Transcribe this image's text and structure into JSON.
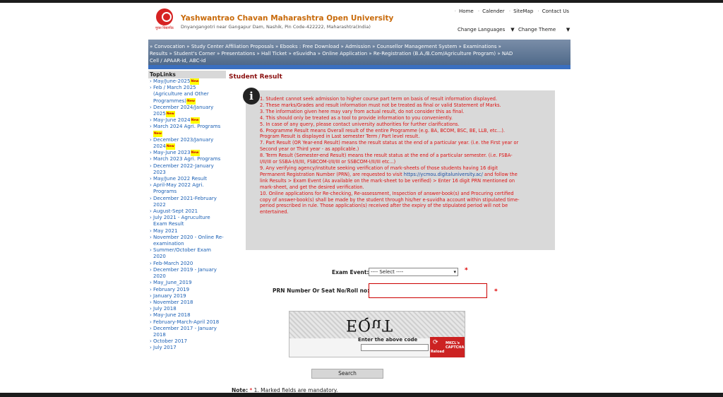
{
  "header": {
    "logo_caption": "मुक्त विद्यापीठ",
    "university_name": "Yashwantrao Chavan Maharashtra Open University",
    "address": "Dnyangangotri near Gangapur Dam, Nashik, Pin Code-422222, Maharashtra(India)",
    "top_links": [
      "Home",
      "Calender",
      "SiteMap",
      "Contact Us"
    ],
    "change_languages": "Change Languages",
    "change_theme": "Change Theme"
  },
  "nav": {
    "line1": "» Convocation   » Study Center Affiliation Proposals   » Ebooks : Free Download   » Admission   » Counsellor Management System   » Examinations   »",
    "line2": "Results   » Student's Corner   » Presentations   » Hall Ticket   » eSuvidha   » Online Application   » Re-Registration (B.A./B.Com/Agriculture Program)   » NAD",
    "line3": "Cell / APAAR-id, ABC-id"
  },
  "sidebar": {
    "heading": "TopLinks",
    "new_badge": "New",
    "items": [
      {
        "label": "May/June-2025",
        "new": true
      },
      {
        "label": "Feb / March 2025 (Agriculture and Other Programmes)",
        "new": true
      },
      {
        "label": "December 2024/January 2025",
        "new": true
      },
      {
        "label": "May-June 2024",
        "new": true
      },
      {
        "label": "March 2024 Agri. Programs",
        "new": true
      },
      {
        "label": "December 2023/January 2024",
        "new": true
      },
      {
        "label": "May-June 2023",
        "new": true
      },
      {
        "label": "March 2023 Agri. Programs",
        "new": false
      },
      {
        "label": "December 2022-January 2023",
        "new": false
      },
      {
        "label": "May/June 2022 Result",
        "new": false
      },
      {
        "label": "April-May 2022 Agri. Programs",
        "new": false
      },
      {
        "label": "December 2021-February 2022",
        "new": false
      },
      {
        "label": "August-Sept 2021",
        "new": false
      },
      {
        "label": "July 2021 - Agruculture Exam Result",
        "new": false
      },
      {
        "label": "May 2021",
        "new": false
      },
      {
        "label": "November 2020 - Online Re-examination",
        "new": false
      },
      {
        "label": "Summer/October Exam 2020",
        "new": false
      },
      {
        "label": "Feb-March 2020",
        "new": false
      },
      {
        "label": "December 2019 - January 2020",
        "new": false
      },
      {
        "label": "May_June_2019",
        "new": false
      },
      {
        "label": "February 2019",
        "new": false
      },
      {
        "label": "January 2019",
        "new": false
      },
      {
        "label": "November 2018",
        "new": false
      },
      {
        "label": "July 2018",
        "new": false
      },
      {
        "label": "May-June 2018",
        "new": false
      },
      {
        "label": "February-March-April 2018",
        "new": false
      },
      {
        "label": "December 2017 - January 2018",
        "new": false
      },
      {
        "label": "October 2017",
        "new": false
      },
      {
        "label": "July 2017",
        "new": false
      }
    ]
  },
  "main": {
    "title": "Student Result",
    "info_icon": "i",
    "info_lines": [
      "1. Student cannot seek admission to higher course part term on basis of result information displayed.",
      "2. These marks/Grades and result information must not be treated as final or valid Statement of Marks.",
      "3. The information given here may vary from actual result, do not consider this as final.",
      "4. This should only be treated as a tool to provide information to you conveniently.",
      "5. In case of any query, please contact university authorities for further clarifications.",
      "6. Programme Result means Overall result of the entire Programme (e.g. BA, BCOM, BSC, BE, LLB, etc...).",
      "Program Result is displayed in Last semester Term / Part level result.",
      "7. Part Result (OR Year-end Result) means the result status at the end of a particular year. (i.e. the First year or",
      "Second year or Third year - as applicable.)",
      "8. Term Result (Semester-end Result) means the result status at the end of a particular semester. (i.e. FSBA-",
      "I/II/III or SSBA-I/II/III, FSBCOM-I/II/III or SSBCOM-I/II/III etc...)",
      "9. Any verifying agency/institute seeking verification of mark-sheets of those students having 16 digit",
      "Permanent Registration Number (PRN), are requested to visit ",
      "link Results > Exam Event (As available on the mark-sheet to be verified) > Enter 16 digit PRN mentioned on",
      "mark-sheet, and get the desired verification.",
      "10. Online applications for Re-checking, Re-assessment, Inspection of answer-book(s) and Procuring certified",
      "copy of answer-book(s) shall be made by the student through his/her e-suvidha account within stipulated time-",
      "period prescribed in rule. Those application(s) received after the expiry of the stipulated period will not be",
      "entertained."
    ],
    "verify_link": "https://ycmou.digitaluniversity.ac/",
    "verify_link_suffix": " and follow the",
    "exam_event_label": "Exam Event:",
    "exam_event_value": "---- Select ----",
    "prn_label": "PRN Number Or Seat No/Roll no:",
    "required_mark": "*",
    "captcha_text": "EQuT",
    "captcha_label": "Enter the above code",
    "reload_label": "Reload",
    "captcha_brand": "MKCL's CAPTCHA",
    "search_label": "Search",
    "note_label": "Note:",
    "note_text": "1. Marked fields are mandatory."
  }
}
